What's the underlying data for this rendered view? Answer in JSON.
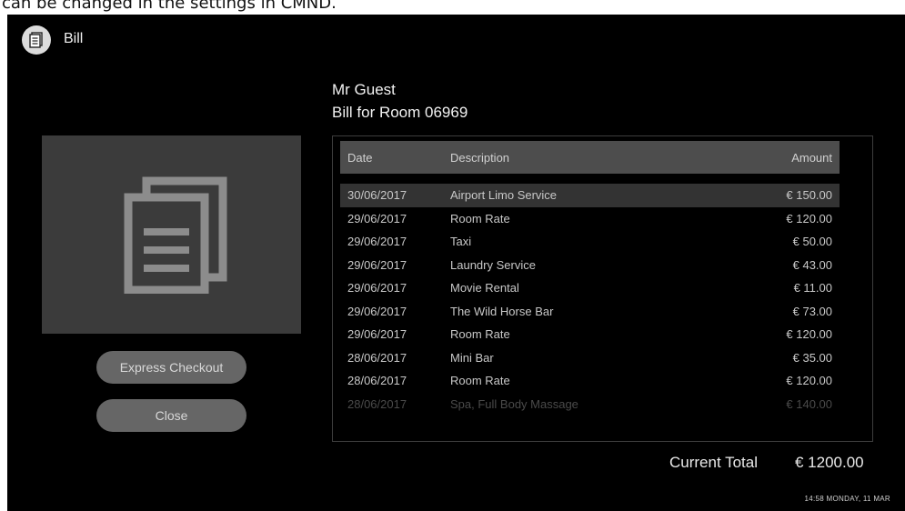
{
  "caption": "can be changed in the settings in CMND.",
  "header": {
    "title": "Bill",
    "icon": "document-icon"
  },
  "guest": {
    "name": "Mr Guest",
    "bill_for": "Bill for Room 06969"
  },
  "illustration": {
    "icon": "documents-icon"
  },
  "buttons": {
    "express_checkout": "Express Checkout",
    "close": "Close"
  },
  "table": {
    "columns": {
      "date": "Date",
      "description": "Description",
      "amount": "Amount"
    },
    "rows": [
      {
        "date": "30/06/2017",
        "description": "Airport Limo Service",
        "amount": "€ 150.00"
      },
      {
        "date": "29/06/2017",
        "description": "Room Rate",
        "amount": "€ 120.00"
      },
      {
        "date": "29/06/2017",
        "description": "Taxi",
        "amount": "€ 50.00"
      },
      {
        "date": "29/06/2017",
        "description": "Laundry Service",
        "amount": "€ 43.00"
      },
      {
        "date": "29/06/2017",
        "description": "Movie Rental",
        "amount": "€ 11.00"
      },
      {
        "date": "29/06/2017",
        "description": "The Wild Horse Bar",
        "amount": "€ 73.00"
      },
      {
        "date": "29/06/2017",
        "description": "Room Rate",
        "amount": "€ 120.00"
      },
      {
        "date": "28/06/2017",
        "description": "Mini Bar",
        "amount": "€ 35.00"
      },
      {
        "date": "28/06/2017",
        "description": "Room Rate",
        "amount": "€ 120.00"
      },
      {
        "date": "28/06/2017",
        "description": "Spa, Full Body Massage",
        "amount": "€ 140.00"
      }
    ]
  },
  "total": {
    "label": "Current Total",
    "value": "€ 1200.00"
  },
  "clock": "14:58 MONDAY, 11 MAR",
  "colors": {
    "background": "#000000",
    "panel": "#3b3b3b",
    "button": "#666666",
    "table_header": "#4d4d4d",
    "selected_row": "#333333"
  }
}
